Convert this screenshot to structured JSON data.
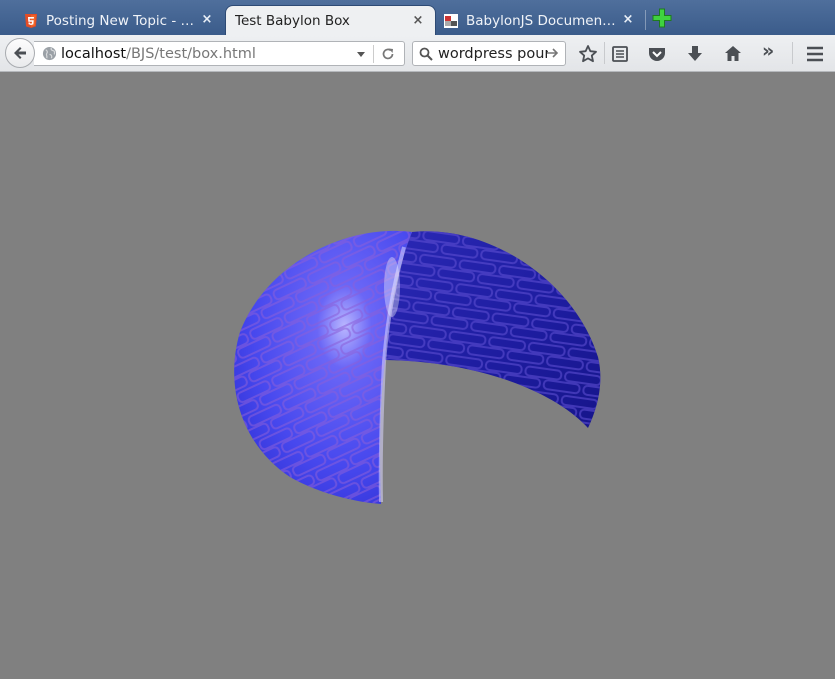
{
  "tabs": [
    {
      "title": "Posting New Topic - …",
      "state": "inactive"
    },
    {
      "title": "Test Babylon Box",
      "state": "active"
    },
    {
      "title": "BabylonJS Documen…",
      "state": "inactive"
    }
  ],
  "address": {
    "host": "localhost",
    "path": "/BJS/test/box.html"
  },
  "search": {
    "value": "wordpress pour"
  },
  "toolbar": {
    "overflow_label": "»"
  },
  "colors": {
    "chrome_tab_strip": "#3f6192",
    "viewport_background": "#808080",
    "mesh_light": "#5c5cf5",
    "mesh_dark": "#1a1aa8"
  },
  "icons": [
    "html5-icon",
    "close-icon",
    "babylon-favicon",
    "plus-icon",
    "back-arrow-icon",
    "globe-icon",
    "chevron-down-icon",
    "reload-icon",
    "search-icon",
    "arrow-right-icon",
    "star-icon",
    "reader-icon",
    "pocket-icon",
    "download-icon",
    "home-icon",
    "menu-icon"
  ]
}
